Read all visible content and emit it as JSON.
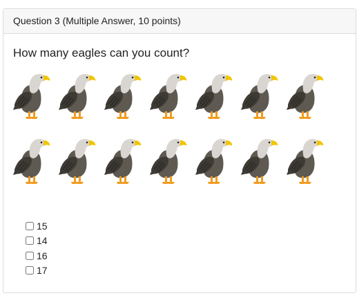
{
  "question": {
    "header": "Question 3 (Multiple Answer, 10 points)",
    "text": "How many eagles can you count?"
  },
  "image": {
    "icon": "eagle-icon",
    "rows": [
      7,
      7
    ]
  },
  "colors": {
    "head": "#d9d6d2",
    "beak": "#f2c400",
    "body": "#5e5a52",
    "wing": "#3e3b35",
    "feet": "#f29b1d"
  },
  "answers": {
    "options": [
      {
        "label": "15",
        "checked": false
      },
      {
        "label": "14",
        "checked": false
      },
      {
        "label": "16",
        "checked": false
      },
      {
        "label": "17",
        "checked": false
      }
    ]
  }
}
